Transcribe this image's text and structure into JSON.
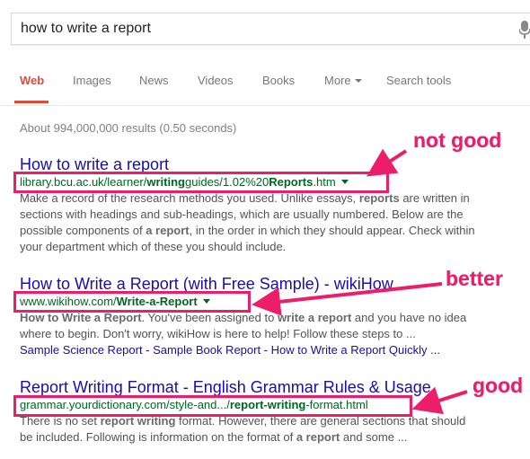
{
  "search": {
    "query": "how to write a report"
  },
  "tabs": [
    {
      "label": "Web"
    },
    {
      "label": "Images"
    },
    {
      "label": "News"
    },
    {
      "label": "Videos"
    },
    {
      "label": "Books"
    },
    {
      "label": "More"
    },
    {
      "label": "Search tools"
    }
  ],
  "stats": "About 994,000,000 results (0.50 seconds)",
  "results": [
    {
      "title": "How to write a report",
      "url_parts": [
        "library.bcu.ac.uk/learner/",
        "writing",
        "guides/1.02%20",
        "Reports",
        ".htm"
      ],
      "snippet_lines": [
        [
          "Make a record of the research methods you used. Unlike essays, ",
          "reports",
          " are written in"
        ],
        [
          "sections with headings and sub-headings, which are usually numbered. Below are the"
        ],
        [
          "possible components of ",
          "a report",
          ", in the order in which they should appear. Check within"
        ],
        [
          "your department which of these you should include."
        ]
      ]
    },
    {
      "title": "How to Write a Report (with Free Sample) - wikiHow",
      "url_parts": [
        "www.wikihow.com/",
        "Write-a-Report"
      ],
      "snippet_lines": [
        [
          "How to Write a Report",
          ". You've been assigned to ",
          "write a report",
          " and you have no idea"
        ],
        [
          "where to begin. Don't worry, wikiHow is here to help! Follow these steps to ..."
        ]
      ],
      "sitelinks": "Sample Science Report - Sample Book Report - How to Write a Report Quickly ..."
    },
    {
      "title": "Report Writing Format - English Grammar Rules & Usage",
      "url_parts": [
        "grammar.yourdictionary.com/style-and.../",
        "report-writing",
        "-format.html"
      ],
      "snippet_lines": [
        [
          "There is no set ",
          "report writing",
          " format. However, there are general sections that should"
        ],
        [
          "be included. Following is information on the format of ",
          "a report",
          " and some ..."
        ]
      ]
    }
  ],
  "annotations": [
    "not good",
    "better",
    "good"
  ],
  "colors": {
    "annotation": "#ec1e6a",
    "link": "#1a0dab",
    "url": "#006621",
    "active_tab": "#dd4b39"
  }
}
